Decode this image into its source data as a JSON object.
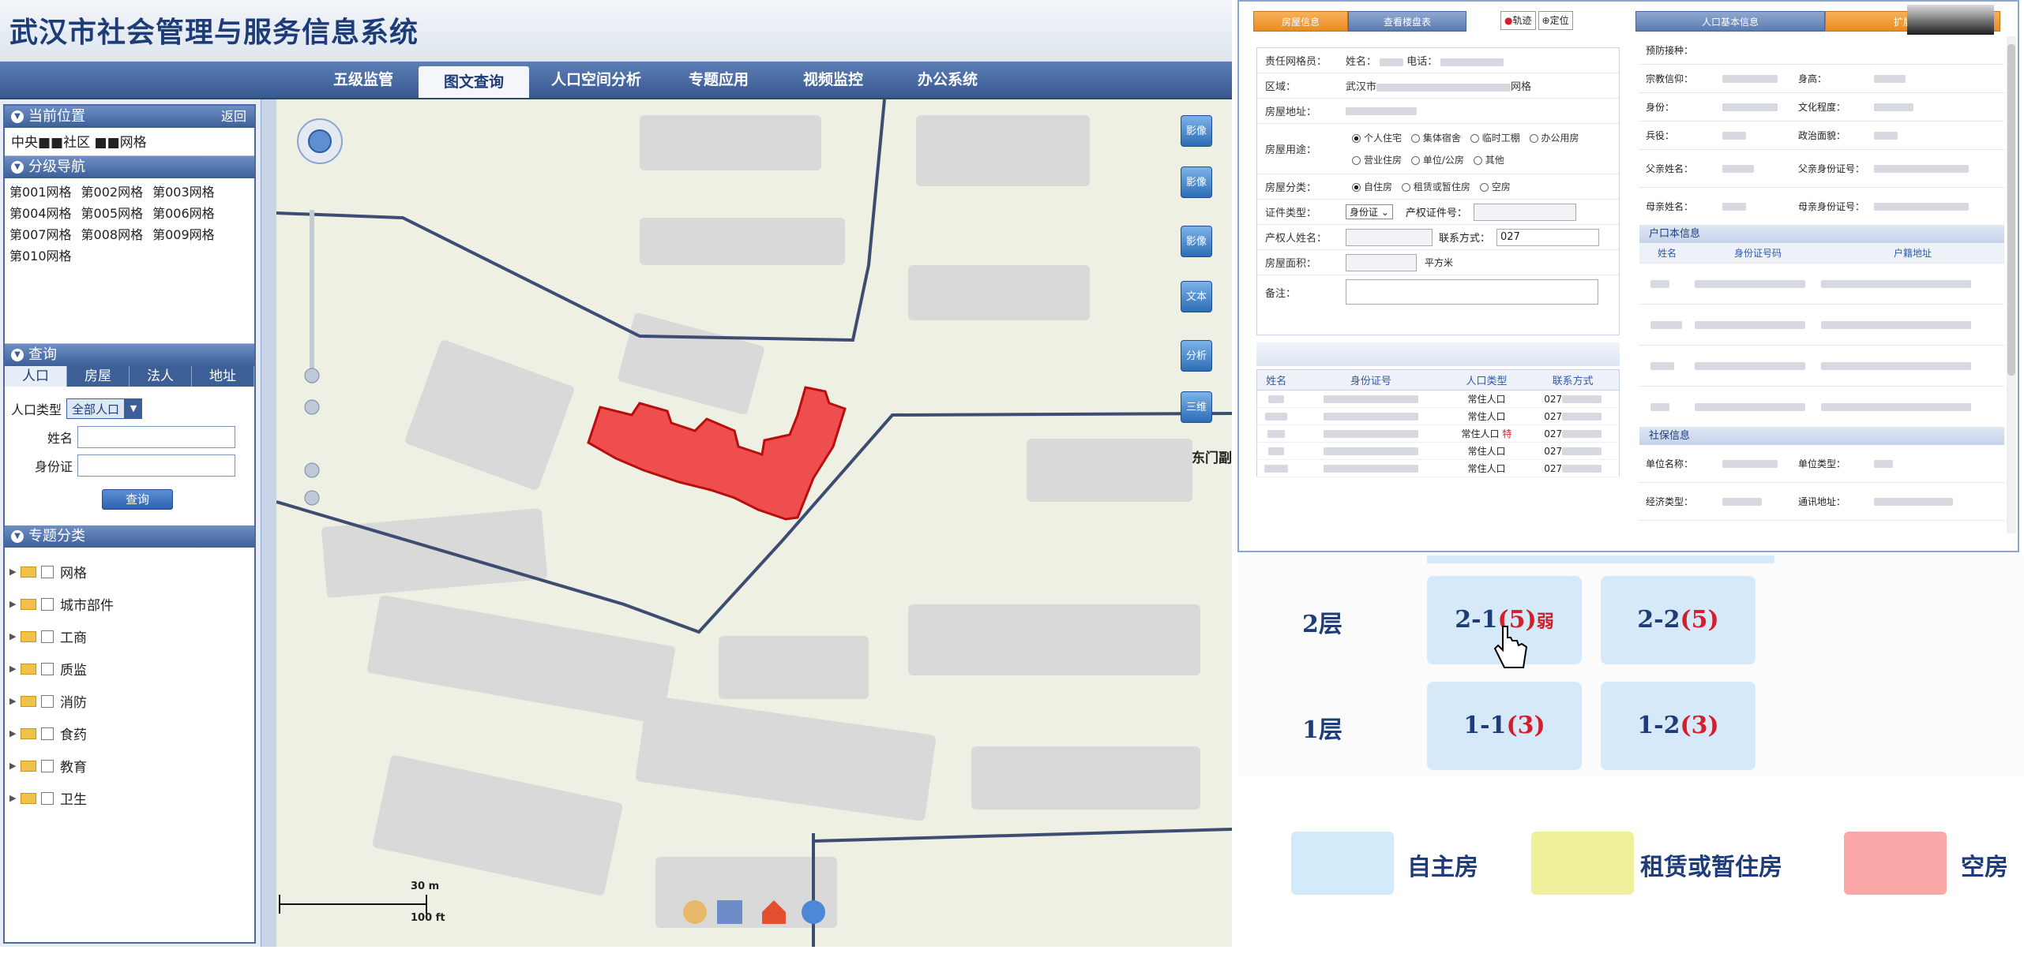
{
  "app": {
    "title": "武汉市社会管理与服务信息系统",
    "nav": [
      {
        "label": "五级监管"
      },
      {
        "label": "图文查询"
      },
      {
        "label": "人口空间分析"
      },
      {
        "label": "专题应用"
      },
      {
        "label": "视频监控"
      },
      {
        "label": "办公系统"
      }
    ]
  },
  "sidebar": {
    "location": {
      "title": "当前位置",
      "back": "返回",
      "value": "中央■■社区 ■■网格"
    },
    "grid_nav": {
      "title": "分级导航",
      "items": [
        "第001网格",
        "第002网格",
        "第003网格",
        "第004网格",
        "第005网格",
        "第006网格",
        "第007网格",
        "第008网格",
        "第009网格",
        "第010网格"
      ]
    },
    "query": {
      "title": "查询",
      "tabs": [
        "人口",
        "房屋",
        "法人",
        "地址"
      ],
      "type_label": "人口类型",
      "type_value": "全部人口",
      "name_label": "姓名",
      "id_label": "身份证",
      "button": "查询"
    },
    "topics": {
      "title": "专题分类",
      "items": [
        "网格",
        "城市部件",
        "工商",
        "质监",
        "消防",
        "食药",
        "教育",
        "卫生"
      ]
    }
  },
  "map": {
    "tools": [
      "影像",
      "影像",
      "影像",
      "文本",
      "分析",
      "三维"
    ],
    "place_label": "东门副",
    "scale_m": "30 m",
    "scale_ft": "100 ft"
  },
  "detail": {
    "tabs_left": [
      "房屋信息",
      "查看楼盘表"
    ],
    "btn_track": "轨迹",
    "btn_locate": "定位",
    "tabs_right": [
      "人口基本信息",
      "扩展信息"
    ],
    "form": {
      "manager_label": "责任网格员：",
      "manager_name": "姓名：",
      "manager_phone": "电话：",
      "area_label": "区域：",
      "area_prefix": "武汉市",
      "area_suffix": "网格",
      "address_label": "房屋地址：",
      "usage_label": "房屋用途：",
      "usage_options": [
        "个人住宅",
        "集体宿舍",
        "临时工棚",
        "办公用房",
        "营业住房",
        "单位/公房",
        "其他"
      ],
      "category_label": "房屋分类：",
      "category_options": [
        "自住房",
        "租赁或暂住房",
        "空房"
      ],
      "cert_type_label": "证件类型：",
      "cert_type_value": "身份证",
      "cert_no_label": "产权证件号：",
      "owner_label": "产权人姓名：",
      "contact_label": "联系方式：",
      "contact_value": "027",
      "size_label": "房屋面积：",
      "size_unit": "平方米",
      "note_label": "备注："
    },
    "residents": {
      "headers": [
        "姓名",
        "身份证号",
        "人口类型",
        "联系方式"
      ],
      "rows": [
        {
          "type": "常住人口",
          "flag": "",
          "phone": "027"
        },
        {
          "type": "常住人口",
          "flag": "",
          "phone": "027"
        },
        {
          "type": "常住人口",
          "flag": "特",
          "phone": "027"
        },
        {
          "type": "常住人口",
          "flag": "",
          "phone": "027"
        },
        {
          "type": "常住人口",
          "flag": "",
          "phone": "027"
        }
      ]
    },
    "person": {
      "vaccination": "预防接种：",
      "religion": "宗教信仰：",
      "height": "身高：",
      "identity": "身份：",
      "education": "文化程度：",
      "military": "兵役：",
      "political": "政治面貌：",
      "father": "父亲姓名：",
      "father_id": "父亲身份证号：",
      "mother": "母亲姓名：",
      "mother_id": "母亲身份证号："
    },
    "household": {
      "title": "户口本信息",
      "headers": [
        "姓名",
        "身份证号码",
        "户籍地址"
      ]
    },
    "social": {
      "title": "社保信息",
      "employer": "单位名称：",
      "employer_type": "单位类型：",
      "economy": "经济类型：",
      "mail": "通讯地址："
    }
  },
  "floorplan": {
    "floors": [
      {
        "label": "2层",
        "units": [
          {
            "id": "2-1",
            "count": "(5)",
            "extra": "弱"
          },
          {
            "id": "2-2",
            "count": "(5)",
            "extra": ""
          }
        ]
      },
      {
        "label": "1层",
        "units": [
          {
            "id": "1-1",
            "count": "(3)",
            "extra": ""
          },
          {
            "id": "1-2",
            "count": "(3)",
            "extra": ""
          }
        ]
      }
    ],
    "legend": [
      {
        "label": "自主房",
        "color": "#d3eafb"
      },
      {
        "label": "租赁或暂住房",
        "color": "#f0ef9a"
      },
      {
        "label": "空房",
        "color": "#f9a7a7"
      }
    ]
  }
}
